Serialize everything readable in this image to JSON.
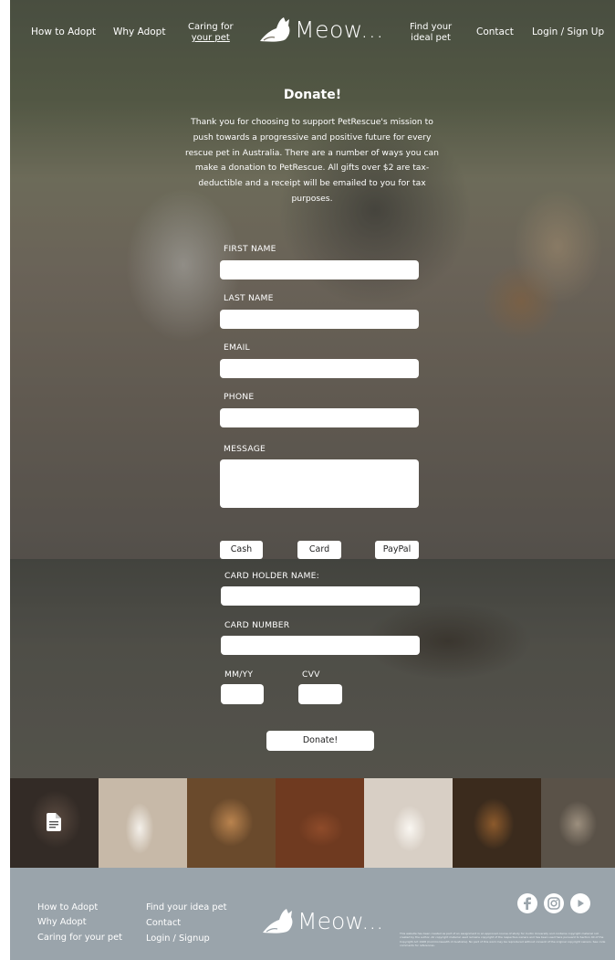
{
  "nav": {
    "how_to_adopt": "How to Adopt",
    "why_adopt": "Why Adopt",
    "caring_line1": "Caring for",
    "caring_line2": "your pet",
    "logo_text": "Meow...",
    "find_line1": "Find your",
    "find_line2": "ideal pet",
    "contact": "Contact",
    "login": "Login / Sign Up"
  },
  "intro": {
    "title": "Donate!",
    "body": "Thank you for choosing to support PetRescue's mission to push towards a progressive and positive future for every rescue pet in Australia. There are a number of ways you can make a donation to PetRescue. All gifts over $2 are tax-deductible and a receipt will be emailed to you for tax purposes."
  },
  "form": {
    "first_name_label": "FIRST NAME",
    "first_name_value": "",
    "last_name_label": "LAST NAME",
    "last_name_value": "",
    "email_label": "EMAIL",
    "email_value": "",
    "phone_label": "PHONE",
    "phone_value": "",
    "message_label": "MESSAGE",
    "message_value": "",
    "payment_options": [
      "Cash",
      "Card",
      "PayPal"
    ],
    "card_holder_label": "CARD HOLDER NAME:",
    "card_holder_value": "",
    "card_number_label": "CARD NUMBER",
    "card_number_value": "",
    "expiry_label": "MM/YY",
    "expiry_value": "",
    "cvv_label": "CVV",
    "cvv_value": "",
    "submit_label": "Donate!"
  },
  "gallery": {
    "icons": [
      "document-icon"
    ]
  },
  "footer": {
    "col1": [
      "How to Adopt",
      "Why Adopt",
      "Caring for your pet"
    ],
    "col2": [
      "Find your idea pet",
      "Contact",
      "Login / Signup"
    ],
    "logo_text": "Meow...",
    "social_icons": [
      "facebook-icon",
      "instagram-icon",
      "youtube-icon"
    ],
    "fine_print": "This website has been created as part of an assignment in an approved course of study for Curtin University and contains copyright material not created by the author. All copyright material used remains copyright of the respective owners and has been used here pursuant to Section 40 of the Copyright Act 1968 (Commonwealth of Australia). No part of this work may be reproduced without consent of the original copyright owners. See code comments for references."
  },
  "colors": {
    "footer_bg": "#9aa4ab",
    "text": "#ffffff",
    "button_bg": "#ffffff"
  }
}
